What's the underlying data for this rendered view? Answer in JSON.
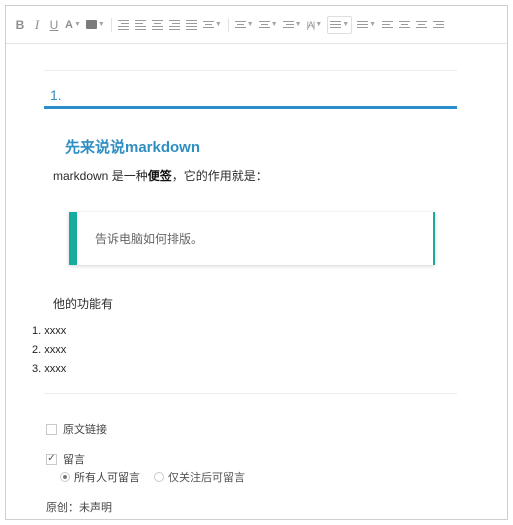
{
  "toolbar": {
    "bold": "B",
    "italic": "I",
    "underline": "U",
    "font_color": "A",
    "letter_spacing": "|A|"
  },
  "section": {
    "number": "1."
  },
  "article": {
    "heading": "先来说说markdown",
    "para_prefix": "markdown 是一种",
    "para_bold": "便签",
    "para_suffix": "，它的作用就是：",
    "quote": "告诉电脑如何排版。",
    "features_title": "他的功能有",
    "list": [
      "1. xxxx",
      "2. xxxx",
      "3. xxxx"
    ]
  },
  "options": {
    "source_link": "原文链接",
    "source_link_checked": false,
    "comments": "留言",
    "comments_checked": true,
    "comment_scope": [
      "所有人可留言",
      "仅关注后可留言"
    ],
    "comment_scope_selected": 0,
    "original_label": "原创：",
    "original_value": "未声明"
  },
  "colors": {
    "accent_blue": "#2b8fcc",
    "quote_teal": "#1aaba0"
  }
}
